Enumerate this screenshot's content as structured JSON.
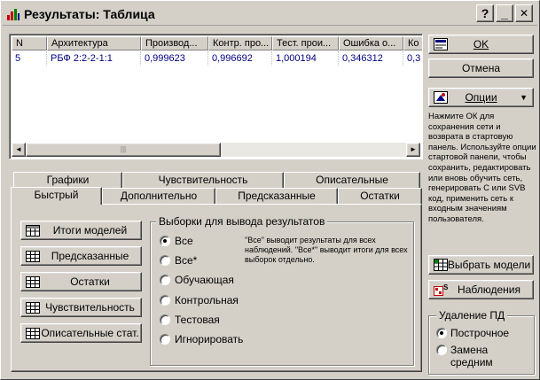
{
  "window": {
    "title": "Результаты: Таблица",
    "help_btn": "?",
    "min_btn": "_",
    "close_btn": "✕"
  },
  "grid": {
    "columns": [
      "N",
      "Архитектура",
      "Производ...",
      "Контр. про...",
      "Тест. прои...",
      "Ошибка о...",
      "Ко"
    ],
    "rows": [
      [
        "5",
        "РБФ 2:2-2-1:1",
        "0,999623",
        "0,996692",
        "1,000194",
        "0,346312",
        "0,3"
      ]
    ],
    "scroll_left": "◄",
    "scroll_right": "►",
    "scroll_thumb": "|||"
  },
  "buttons": {
    "ok": "OK",
    "cancel": "Отмена",
    "options": "Опции",
    "options_arrow": "▼",
    "select_model": "Выбрать модели",
    "cases": "Наблюдения"
  },
  "help_text": "Нажмите ОК для сохранения сети и возврата в стартовую панель. Используйте опции стартовой панели, чтобы сохранить, редактировать или вновь обучить сеть, генерировать С или SVB код, применить сеть к входным значениям пользователя.",
  "missing_group": {
    "title": "Удаление ПД",
    "options": [
      "Построчное",
      "Замена средним"
    ],
    "selected": 0
  },
  "tabs_row1": [
    "Графики",
    "Чувствительность",
    "Описательные"
  ],
  "tabs_row2": [
    "Быстрый",
    "Дополнительно",
    "Предсказанные",
    "Остатки"
  ],
  "active_tab": "Быстрый",
  "quick_buttons": [
    "Итоги моделей",
    "Предсказанные",
    "Остатки",
    "Чувствительность",
    "Описательные стат."
  ],
  "samples_group": {
    "title": "Выборки для вывода результатов",
    "options": [
      "Все",
      "Все*",
      "Обучающая",
      "Контрольная",
      "Тестовая",
      "Игнорировать"
    ],
    "selected": 0,
    "note": "\"Все\" выводит результаты для всех наблюдений. \"Все*\" выводит итоги для всех выборок отдельно."
  },
  "colors": {
    "face": "#d4d0c8",
    "data_text": "#000080",
    "icon_green": "#008000",
    "icon_red": "#c00000"
  }
}
